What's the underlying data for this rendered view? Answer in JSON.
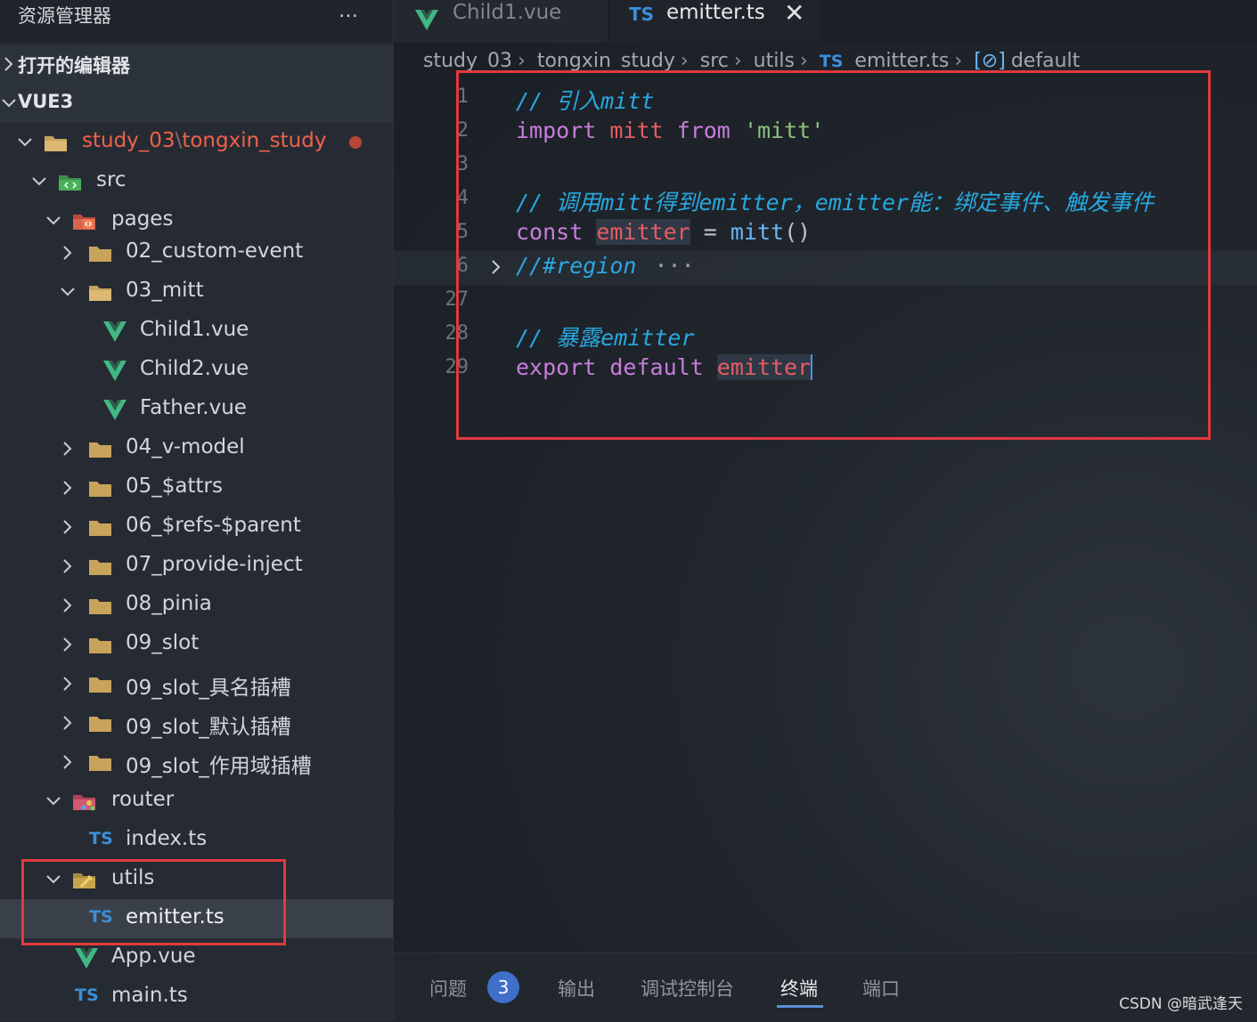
{
  "explorer": {
    "title": "资源管理器",
    "more_icon": "…",
    "open_editors": "打开的编辑器",
    "workspace": "VUE3",
    "root": {
      "part1": "study_03",
      "sep": "\\",
      "part2": "tongxin_study"
    },
    "tree": {
      "src": "src",
      "pages": "pages",
      "custom_event": "02_custom-event",
      "mitt": "03_mitt",
      "child1": "Child1.vue",
      "child2": "Child2.vue",
      "father": "Father.vue",
      "vmodel": "04_v-model",
      "attrs": "05_$attrs",
      "refs": "06_$refs-$parent",
      "provide": "07_provide-inject",
      "pinia": "08_pinia",
      "slot": "09_slot",
      "slot_named": "09_slot_具名插槽",
      "slot_default": "09_slot_默认插槽",
      "slot_scoped": "09_slot_作用域插槽",
      "router": "router",
      "router_index": "index.ts",
      "utils": "utils",
      "emitter": "emitter.ts",
      "app": "App.vue",
      "main": "main.ts"
    },
    "ts_label": "TS"
  },
  "tabs": {
    "inactive": "Child1.vue",
    "active_prefix": "TS",
    "active": "emitter.ts",
    "close": "✕"
  },
  "breadcrumb": {
    "items": [
      "study_03",
      "tongxin_study",
      "src",
      "utils"
    ],
    "file_prefix": "TS",
    "file": "emitter.ts",
    "symbol_icon": "[⊘]",
    "symbol": "default",
    "sep": "›"
  },
  "code": {
    "line_numbers": [
      "1",
      "2",
      "3",
      "4",
      "5",
      "6",
      "27",
      "28",
      "29"
    ],
    "l1": "// 引入mitt",
    "l2": {
      "import": "import",
      "mitt": "mitt",
      "from": "from",
      "str": "'mitt'"
    },
    "l4": "// 调用mitt得到emitter，emitter能：绑定事件、触发事件",
    "l5": {
      "const": "const",
      "emitter": "emitter",
      "eq": "=",
      "mitt": "mitt",
      "paren": "()"
    },
    "l6": "//#region",
    "l6_ellipsis": "···",
    "l28": "// 暴露emitter",
    "l29": {
      "export": "export",
      "default": "default",
      "emitter": "emitter"
    }
  },
  "panel": {
    "problems": "问题",
    "problems_count": "3",
    "output": "输出",
    "debug": "调试控制台",
    "terminal": "终端",
    "ports": "端口"
  },
  "watermark": "CSDN @暗武逢天",
  "colors": {
    "accent": "#3f6fc8",
    "highlight_box": "#e0393e",
    "error_text": "#f0614a"
  }
}
